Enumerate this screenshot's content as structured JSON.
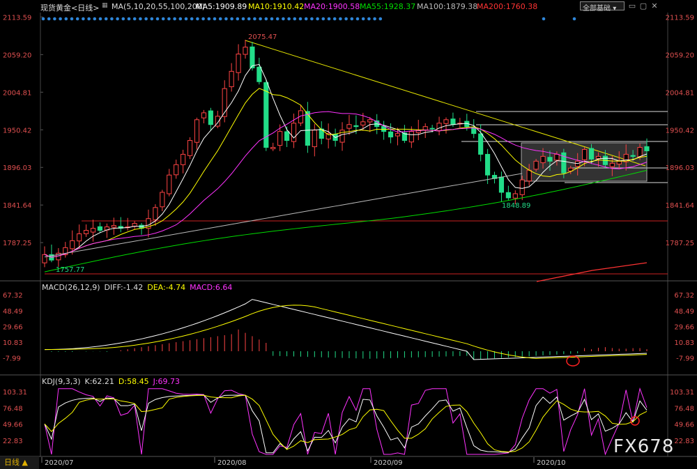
{
  "header": {
    "title": "现货黄金<日线>",
    "ma_params": "MA(5,10,20,55,100,200)",
    "ma_items": [
      {
        "label": "MA5:1909.89",
        "color": "#ffffff"
      },
      {
        "label": "MA10:1910.42",
        "color": "#ffff00"
      },
      {
        "label": "MA20:1900.58",
        "color": "#ff33ff"
      },
      {
        "label": "MA55:1928.37",
        "color": "#00dd00"
      },
      {
        "label": "MA100:1879.38",
        "color": "#bbbbbb"
      },
      {
        "label": "MA200:1760.38",
        "color": "#ff3333"
      }
    ],
    "dropdown": "全部基础"
  },
  "macd_header": {
    "label": "MACD(26,12,9)",
    "diff": "DIFF:-1.42",
    "dea": "DEA:-4.74",
    "macd": "MACD:6.64"
  },
  "kdj_header": {
    "label": "KDJ(9,3,3)",
    "k": "K:62.21",
    "d": "D:58.45",
    "j": "J:69.73"
  },
  "price_axis": [
    "2113.59",
    "2059.20",
    "2004.81",
    "1950.42",
    "1896.03",
    "1841.64",
    "1787.25"
  ],
  "macd_axis": [
    "67.32",
    "48.49",
    "29.66",
    "10.83",
    "-7.99"
  ],
  "kdj_axis": [
    "103.31",
    "76.48",
    "49.66",
    "22.83"
  ],
  "date_labels": [
    "2020/07",
    "2020/08",
    "2020/09",
    "2020/10"
  ],
  "annotations": {
    "high": "2075.47",
    "low1": "1757.77",
    "low2": "1848.89"
  },
  "bottom_tab": "日线 ▲",
  "watermark": "FX678",
  "colors": {
    "up": "#ff4444",
    "down": "#22dd88",
    "ma5": "#ffffff",
    "ma10": "#ffff00",
    "ma20": "#ff33ff",
    "ma55": "#00dd00",
    "ma100": "#bbbbbb",
    "ma200": "#ff3333"
  },
  "chart_data": {
    "type": "candlestick",
    "price_range": [
      1735,
      2120
    ],
    "ohlc_anchor_closes": [
      1770,
      1762,
      1772,
      1780,
      1790,
      1800,
      1805,
      1808,
      1805,
      1810,
      1812,
      1808,
      1810,
      1815,
      1808,
      1822,
      1838,
      1860,
      1885,
      1900,
      1915,
      1935,
      1965,
      1975,
      1958,
      1970,
      2010,
      2035,
      2060,
      2070,
      2040,
      2020,
      1925,
      1925,
      1948,
      1935,
      1960,
      1978,
      1928,
      1950,
      1938,
      1945,
      1935,
      1950,
      1958,
      1955,
      1962,
      1965,
      1955,
      1948,
      1940,
      1945,
      1935,
      1948,
      1950,
      1955,
      1952,
      1960,
      1965,
      1958,
      1960,
      1955,
      1945,
      1915,
      1885,
      1880,
      1860,
      1852,
      1858,
      1878,
      1892,
      1905,
      1912,
      1905,
      1915,
      1888,
      1895,
      1905,
      1922,
      1908,
      1912,
      1900,
      1902,
      1905,
      1915,
      1912,
      1925,
      1920
    ],
    "macd": {
      "diff": -1.42,
      "dea": -4.74,
      "macd": 6.64,
      "range": [
        -15,
        70
      ]
    },
    "kdj": {
      "k": 62.21,
      "d": 58.45,
      "j": 69.73,
      "range": [
        0,
        110
      ]
    }
  }
}
